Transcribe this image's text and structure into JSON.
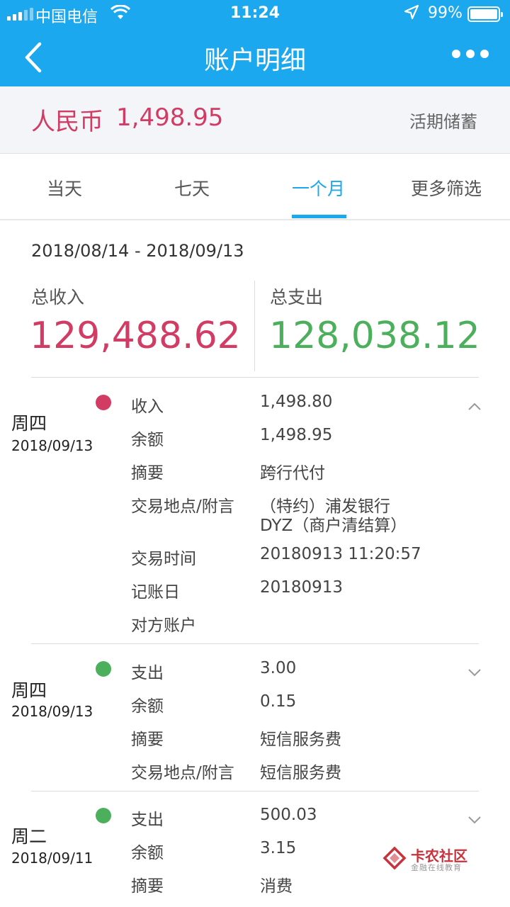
{
  "status_bar": {
    "carrier": "中国电信",
    "time": "11:24",
    "battery": "99%"
  },
  "nav": {
    "title": "账户明细"
  },
  "account": {
    "currency": "人民币",
    "balance": "1,498.95",
    "type": "活期储蓄"
  },
  "tabs": [
    "当天",
    "七天",
    "一个月",
    "更多筛选"
  ],
  "active_tab": "一个月",
  "summary": {
    "date_range": "2018/08/14 - 2018/09/13",
    "income_label": "总收入",
    "income": "129,488.62",
    "expense_label": "总支出",
    "expense": "128,038.12"
  },
  "transactions": [
    {
      "weekday": "周四",
      "date": "2018/09/13",
      "type": "收入",
      "amount": "1,498.80",
      "rows": [
        {
          "label": "余额",
          "value": "1,498.95"
        },
        {
          "label": "摘要",
          "value": "跨行代付"
        },
        {
          "label": "交易地点/附言",
          "value": "（特约）浦发银行",
          "value2": "DYZ（商户清结算）"
        },
        {
          "label": "交易时间",
          "value": "20180913 11:20:57"
        },
        {
          "label": "记账日",
          "value": "20180913"
        },
        {
          "label": "对方账户",
          "value": ""
        }
      ]
    },
    {
      "weekday": "周四",
      "date": "2018/09/13",
      "type": "支出",
      "amount": "3.00",
      "rows": [
        {
          "label": "余额",
          "value": "0.15"
        },
        {
          "label": "摘要",
          "value": "短信服务费"
        },
        {
          "label": "交易地点/附言",
          "value": "短信服务费"
        }
      ]
    },
    {
      "weekday": "周二",
      "date": "2018/09/11",
      "type": "支出",
      "amount": "500.03",
      "rows": [
        {
          "label": "余额",
          "value": "3.15"
        },
        {
          "label": "摘要",
          "value": "消费"
        }
      ]
    }
  ],
  "watermark": {
    "name": "卡农社区",
    "tagline": "金融在线教育"
  },
  "colors": {
    "brand": "#1ba8ef",
    "income": "#d23c64",
    "expense": "#4caf5c"
  }
}
